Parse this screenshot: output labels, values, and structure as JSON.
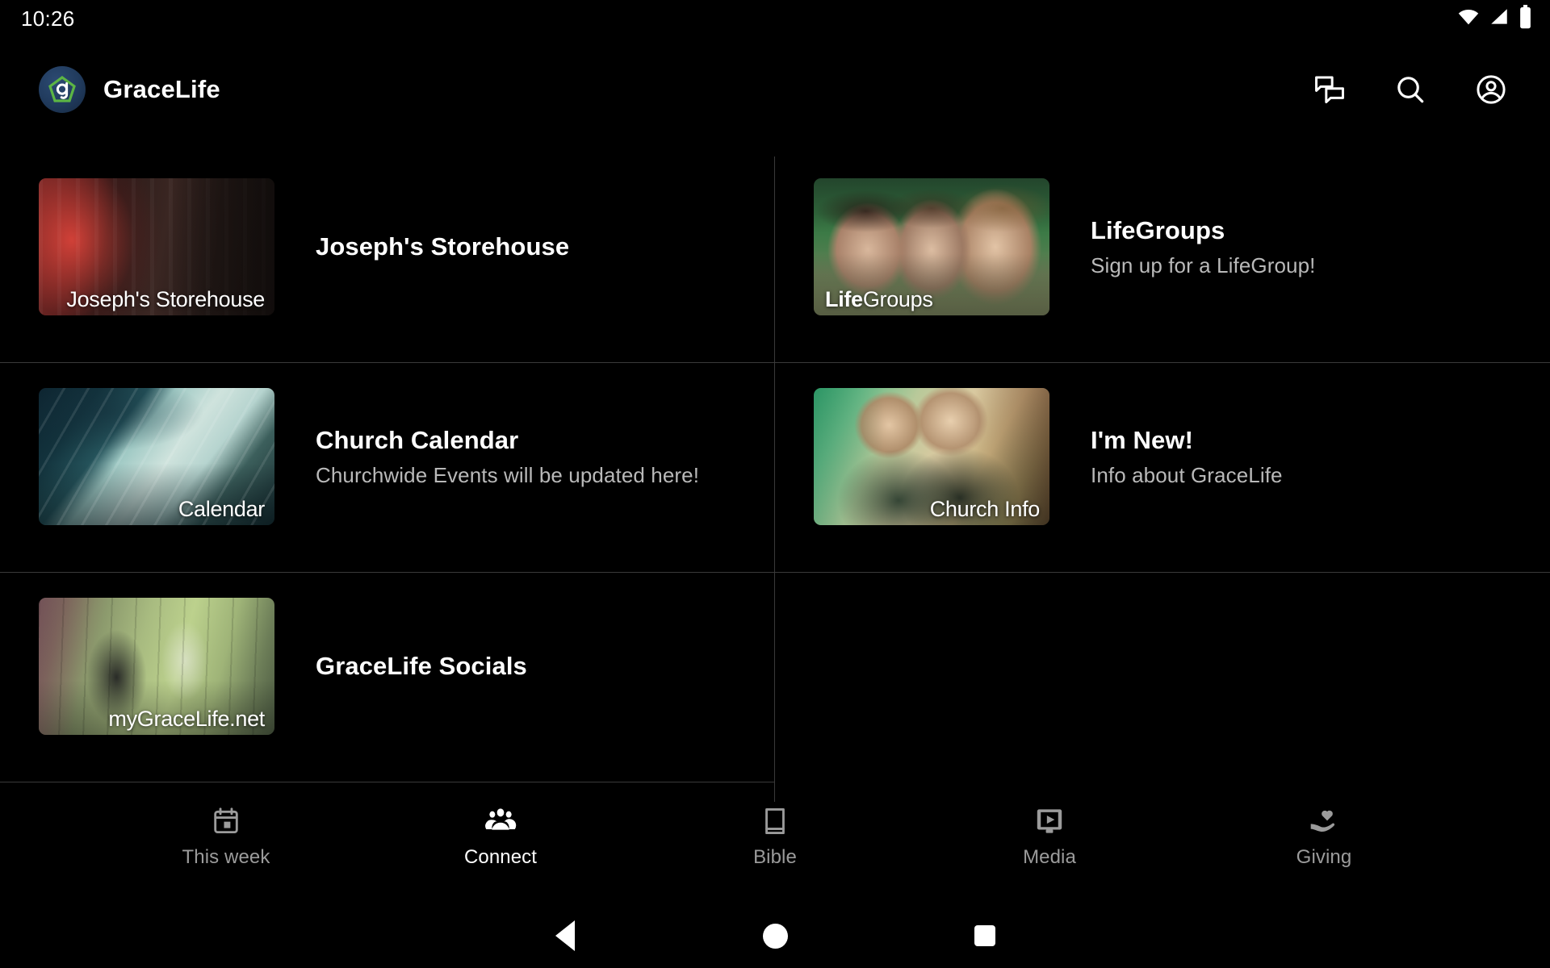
{
  "status_bar": {
    "clock": "10:26",
    "icons": [
      "wifi-icon",
      "cellular-signal-icon",
      "battery-icon"
    ]
  },
  "app_bar": {
    "logo_icon": "gracelife-logo-icon",
    "logo_colors": {
      "circle": "#203a5c",
      "pentagon": "#5cb544",
      "letters": "#ffffff"
    },
    "title": "GraceLife",
    "actions": [
      {
        "name": "messages-icon",
        "label": "Messages"
      },
      {
        "name": "search-icon",
        "label": "Search"
      },
      {
        "name": "account-icon",
        "label": "Account"
      }
    ]
  },
  "grid": {
    "rows": [
      {
        "cells": [
          {
            "title": "Joseph's Storehouse",
            "subtitle": "",
            "thumb_caption": "Joseph's Storehouse",
            "thumb_caption_bold": "",
            "thumb_caption_align": "right",
            "art": "art-storehouse"
          },
          {
            "title": "LifeGroups",
            "subtitle": "Sign up for a LifeGroup!",
            "thumb_caption_bold": "Life",
            "thumb_caption": "Groups",
            "thumb_caption_align": "left",
            "art": "art-lifegroups"
          }
        ]
      },
      {
        "cells": [
          {
            "title": "Church Calendar",
            "subtitle": "Churchwide Events will be updated here!",
            "thumb_caption": "Calendar",
            "thumb_caption_bold": "",
            "thumb_caption_align": "right",
            "art": "art-calendar"
          },
          {
            "title": "I'm New!",
            "subtitle": "Info about GraceLife",
            "thumb_caption": "Church Info",
            "thumb_caption_bold": "",
            "thumb_caption_align": "right",
            "art": "art-churchinfo"
          }
        ]
      },
      {
        "cells": [
          {
            "title": "GraceLife Socials",
            "subtitle": "",
            "thumb_caption": "myGraceLife.net",
            "thumb_caption_bold": "",
            "thumb_caption_align": "right",
            "art": "art-socials"
          },
          {
            "title": "",
            "subtitle": "",
            "thumb_caption": "",
            "thumb_caption_bold": "",
            "art": ""
          }
        ]
      }
    ],
    "divider_color": "#3a3a3a"
  },
  "tab_bar": {
    "active_index": 1,
    "tabs": [
      {
        "label": "This week",
        "icon": "calendar-icon"
      },
      {
        "label": "Connect",
        "icon": "people-group-icon"
      },
      {
        "label": "Bible",
        "icon": "book-icon"
      },
      {
        "label": "Media",
        "icon": "media-play-icon"
      },
      {
        "label": "Giving",
        "icon": "hand-heart-icon"
      }
    ],
    "active_color": "#ffffff",
    "inactive_color": "#9b9b9b"
  },
  "system_nav": {
    "buttons": [
      {
        "name": "android-back-button",
        "label": "Back"
      },
      {
        "name": "android-home-button",
        "label": "Home"
      },
      {
        "name": "android-recents-button",
        "label": "Recents"
      }
    ]
  }
}
